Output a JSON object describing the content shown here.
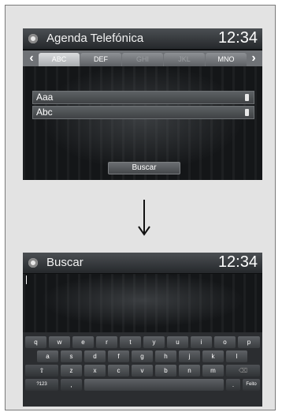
{
  "screen1": {
    "title": "Agenda Telefónica",
    "clock": "12:34",
    "tabs": [
      {
        "label": "ABC",
        "state": "active"
      },
      {
        "label": "DEF",
        "state": "normal"
      },
      {
        "label": "GHI",
        "state": "disabled"
      },
      {
        "label": "JKL",
        "state": "disabled"
      },
      {
        "label": "MNO",
        "state": "normal"
      }
    ],
    "contacts": [
      {
        "name": "Aaa",
        "icon": "phone-icon"
      },
      {
        "name": "Abc",
        "icon": "phone-icon"
      }
    ],
    "search_button": "Buscar"
  },
  "transition_icon": "down-arrow-icon",
  "screen2": {
    "title": "Buscar",
    "clock": "12:34",
    "keyboard": {
      "row1": [
        "q",
        "w",
        "e",
        "r",
        "t",
        "y",
        "u",
        "i",
        "o",
        "p"
      ],
      "row2": [
        "a",
        "s",
        "d",
        "f",
        "g",
        "h",
        "j",
        "k",
        "l"
      ],
      "row3": [
        "z",
        "x",
        "c",
        "v",
        "b",
        "n",
        "m"
      ],
      "shift_icon": "shift-icon",
      "backspace_icon": "backspace-icon",
      "symbols_label": "?123",
      "comma_label": ",",
      "period_label": ".",
      "done_label": "Feito"
    }
  }
}
